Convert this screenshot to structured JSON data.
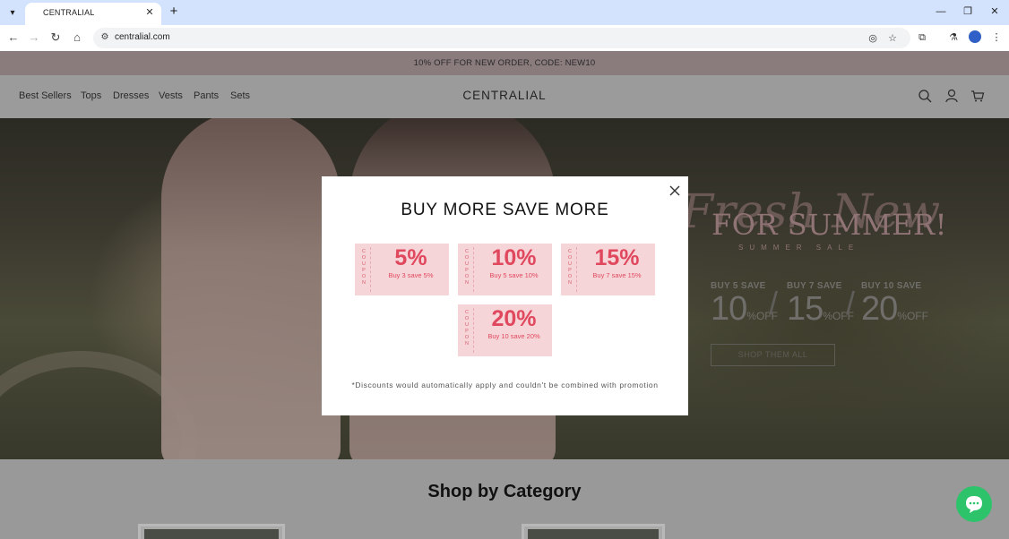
{
  "browser": {
    "tab_title": "CENTRALIAL",
    "url": "centralial.com"
  },
  "site": {
    "promo_bar": "10% OFF FOR NEW ORDER, CODE: NEW10",
    "brand": "CENTRALIAL",
    "nav": [
      "Best Sellers",
      "Tops",
      "Dresses",
      "Vests",
      "Pants",
      "Sets"
    ]
  },
  "hero": {
    "script": "Fresh New",
    "title": "FOR SUMMER!",
    "subtitle": "SUMMER SALE",
    "deals": [
      {
        "label": "BUY 5 SAVE",
        "value": "10",
        "suffix": "%OFF"
      },
      {
        "label": "BUY 7 SAVE",
        "value": "15",
        "suffix": "%OFF"
      },
      {
        "label": "BUY 10 SAVE",
        "value": "20",
        "suffix": "%OFF"
      }
    ],
    "cta": "SHOP THEM ALL"
  },
  "category_section": {
    "title": "Shop by Category"
  },
  "modal": {
    "title": "BUY MORE SAVE MORE",
    "coupon_label": "COUPON",
    "coupons": [
      {
        "percent": "5%",
        "desc": "Buy 3 save 5%"
      },
      {
        "percent": "10%",
        "desc": "Buy 5 save 10%"
      },
      {
        "percent": "15%",
        "desc": "Buy 7 save 15%"
      },
      {
        "percent": "20%",
        "desc": "Buy 10 save 20%"
      }
    ],
    "note": "*Discounts would automatically apply and couldn't be combined with promotion"
  },
  "colors": {
    "coupon_bg": "#f6d5d8",
    "coupon_accent": "#e0485e",
    "chat": "#2cc36b",
    "browser_tabbar": "#d3e3fd"
  }
}
